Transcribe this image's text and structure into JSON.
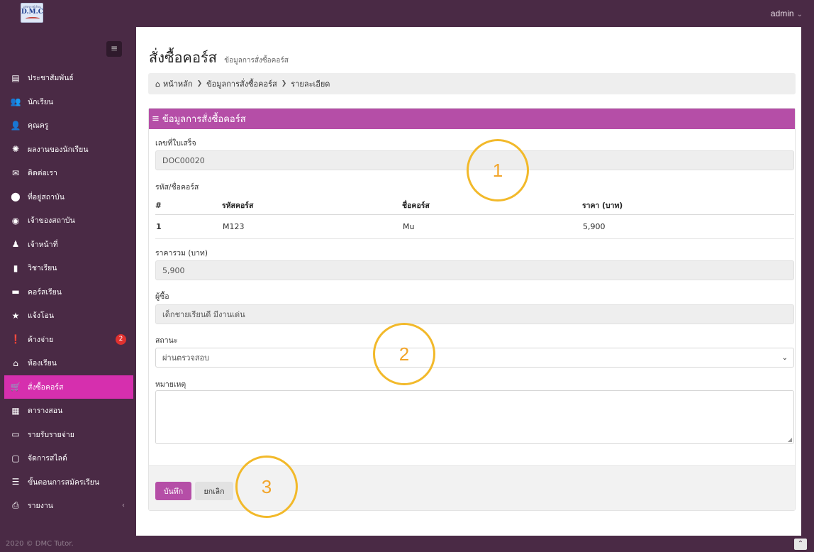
{
  "header": {
    "logo": {
      "top_text": "มหัศจรรย์เรียน",
      "main_text": "D.M.C"
    },
    "user": "admin"
  },
  "sidebar": {
    "items": [
      {
        "label": "ประชาสัมพันธ์",
        "icon": "newspaper-icon",
        "glyph": "▤"
      },
      {
        "label": "นักเรียน",
        "icon": "users-icon",
        "glyph": "👥"
      },
      {
        "label": "คุณครู",
        "icon": "user-icon",
        "glyph": "👤"
      },
      {
        "label": "ผลงานของนักเรียน",
        "icon": "certificate-icon",
        "glyph": "✺"
      },
      {
        "label": "ติดต่อเรา",
        "icon": "envelope-open-icon",
        "glyph": "✉"
      },
      {
        "label": "ที่อยู่สถาบัน",
        "icon": "map-marker-icon",
        "glyph": "⬤"
      },
      {
        "label": "เจ้าของสถาบัน",
        "icon": "user-circle-icon",
        "glyph": "◉"
      },
      {
        "label": "เจ้าหน้าที่",
        "icon": "user-secret-icon",
        "glyph": "♟"
      },
      {
        "label": "วิชาเรียน",
        "icon": "file-icon",
        "glyph": "▮"
      },
      {
        "label": "คอร์สเรียน",
        "icon": "book-icon",
        "glyph": "▬"
      },
      {
        "label": "แจ้งโอน",
        "icon": "star-icon",
        "glyph": "★"
      },
      {
        "label": "ค้างจ่าย",
        "icon": "exclamation-circle-icon",
        "glyph": "❗",
        "badge": "2"
      },
      {
        "label": "ห้องเรียน",
        "icon": "home-icon",
        "glyph": "⌂"
      },
      {
        "label": "สั่งซื้อคอร์ส",
        "icon": "shopping-cart-icon",
        "glyph": "🛒",
        "active": true
      },
      {
        "label": "ตารางสอน",
        "icon": "calendar-icon",
        "glyph": "▦"
      },
      {
        "label": "รายรับรายจ่าย",
        "icon": "money-icon",
        "glyph": "▭"
      },
      {
        "label": "จัดการสไลด์",
        "icon": "desktop-icon",
        "glyph": "▢"
      },
      {
        "label": "ขั้นตอนการสมัครเรียน",
        "icon": "th-list-icon",
        "glyph": "☰"
      },
      {
        "label": "รายงาน",
        "icon": "print-icon",
        "glyph": "⎙",
        "chevron": "‹"
      }
    ],
    "footer": "2020 © DMC Tutor."
  },
  "page": {
    "title": "สั่งซื้อคอร์ส",
    "subtitle": "ข้อมูลการสั่งซื้อคอร์ส",
    "breadcrumb": [
      "หน้าหลัก",
      "ข้อมูลการสั่งซื้อคอร์ส",
      "รายละเอียด"
    ]
  },
  "card": {
    "header": "ข้อมูลการสั่งซื้อคอร์ส",
    "receipt_label": "เลขที่ใบเสร็จ",
    "receipt_value": "DOC00020",
    "course_label": "รหัส/ชื่อคอร์ส",
    "table": {
      "headers": [
        "#",
        "รหัสคอร์ส",
        "ชื่อคอร์ส",
        "ราคา (บาท)"
      ],
      "rows": [
        [
          "1",
          "M123",
          "Mu",
          "5,900"
        ]
      ]
    },
    "total_label": "ราคารวม (บาท)",
    "total_value": "5,900",
    "buyer_label": "ผู้ซื้อ",
    "buyer_value": "เด็กชายเรียนดี มีงานเด่น",
    "status_label": "สถานะ",
    "status_value": "ผ่านตรวจสอบ",
    "note_label": "หมายเหตุ",
    "note_value": "",
    "save_label": "บันทึก",
    "cancel_label": "ยกเลิก"
  },
  "callouts": [
    "1",
    "2",
    "3"
  ],
  "colors": {
    "sidebar_bg": "#4a2a45",
    "active_item": "#d62fae",
    "card_header": "#b54ea7",
    "callout": "#f2b92a",
    "badge": "#e0312f"
  }
}
